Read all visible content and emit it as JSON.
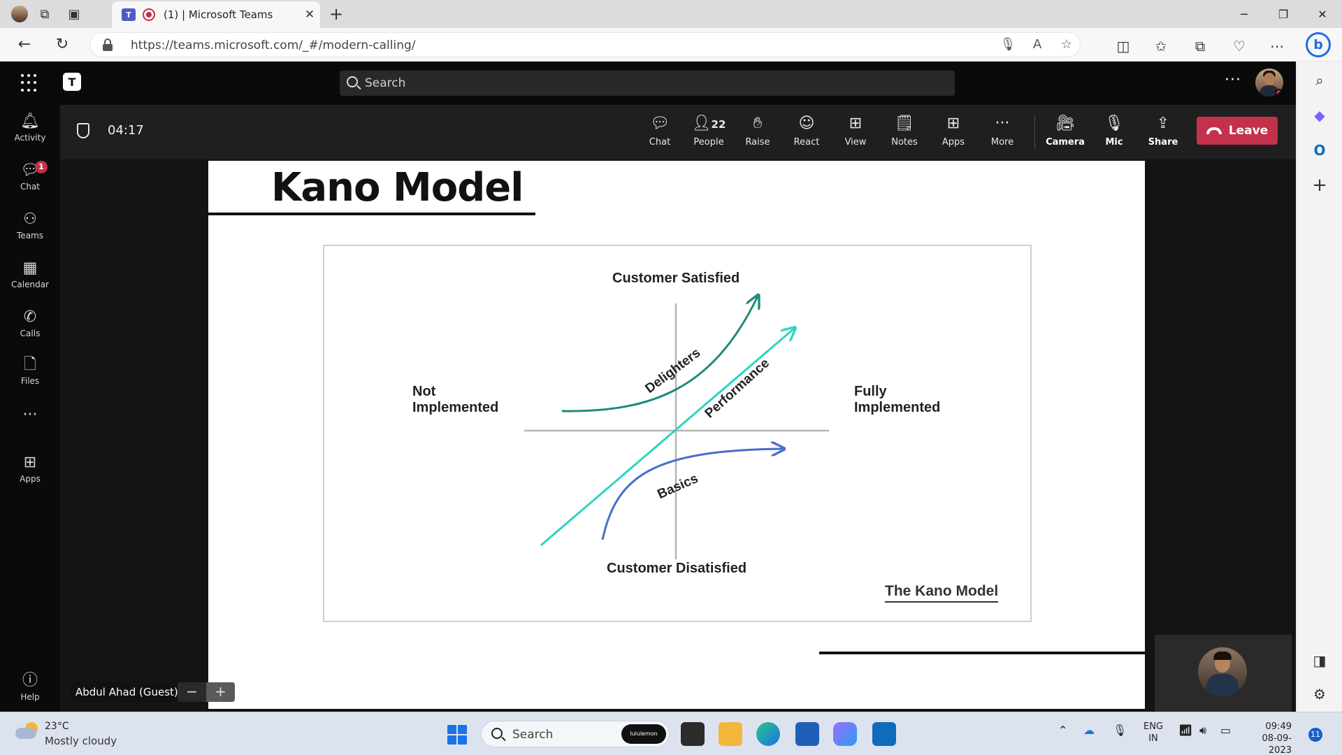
{
  "browser": {
    "tab_title": "(1) | Microsoft Teams",
    "url": "https://teams.microsoft.com/_#/modern-calling/"
  },
  "teams": {
    "search_placeholder": "Search",
    "rail": [
      {
        "label": "Activity",
        "icon": "bell-icon"
      },
      {
        "label": "Chat",
        "icon": "chat-icon",
        "badge": "1"
      },
      {
        "label": "Teams",
        "icon": "teams-icon"
      },
      {
        "label": "Calendar",
        "icon": "calendar-icon"
      },
      {
        "label": "Calls",
        "icon": "phone-icon"
      },
      {
        "label": "Files",
        "icon": "file-icon"
      },
      {
        "label": "Apps",
        "icon": "apps-icon"
      },
      {
        "label": "Help",
        "icon": "help-icon"
      }
    ]
  },
  "meeting": {
    "timer": "04:17",
    "controls": {
      "chat": "Chat",
      "people": "People",
      "people_count": "22",
      "raise": "Raise",
      "react": "React",
      "view": "View",
      "notes": "Notes",
      "apps": "Apps",
      "more": "More",
      "camera": "Camera",
      "mic": "Mic",
      "share": "Share",
      "leave": "Leave"
    },
    "presenter_name": "Abdul Ahad (Guest)",
    "slide": {
      "title": "Kano Model",
      "diagram": {
        "top_label": "Customer Satisfied",
        "bottom_label": "Customer Disatisfied",
        "left_label_line1": "Not",
        "left_label_line2": "Implemented",
        "right_label_line1": "Fully",
        "right_label_line2": "Implemented",
        "curve_delighters": "Delighters",
        "curve_performance": "Performance",
        "curve_basics": "Basics",
        "caption": "The Kano Model",
        "colors": {
          "delighters": "#1f8a7a",
          "performance": "#2ad6c0",
          "basics": "#4a6ecc",
          "axes": "#b5b5b5"
        }
      }
    }
  },
  "taskbar": {
    "temperature": "23°C",
    "condition": "Mostly cloudy",
    "search_placeholder": "Search",
    "search_badge": "lululemon",
    "lang_line1": "ENG",
    "lang_line2": "IN",
    "time": "09:49",
    "date": "08-09-2023",
    "notifications": "11"
  }
}
